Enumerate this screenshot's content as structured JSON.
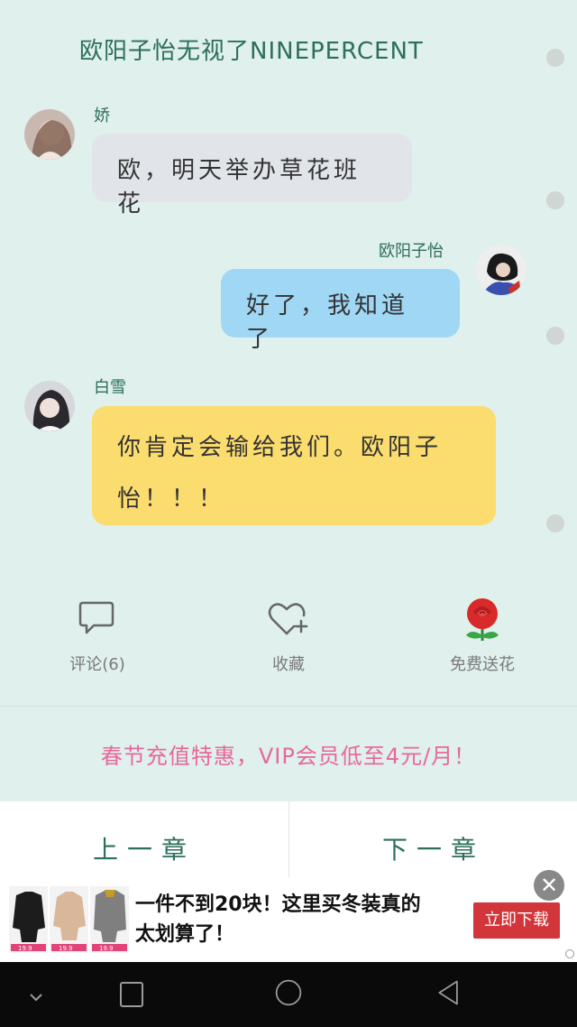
{
  "chapter": {
    "title": "欧阳子怡无视了NINEPERCENT"
  },
  "messages": [
    {
      "sender": "娇",
      "text": "欧，明天举办草花班花",
      "side": "left",
      "bubble_color": "#e1e5ea"
    },
    {
      "sender": "欧阳子怡",
      "text": "好了，我知道了",
      "side": "right",
      "bubble_color": "#9fd7f4"
    },
    {
      "sender": "白雪",
      "text_line1": "你肯定会输给我们。欧阳子",
      "text_line2": "怡！！！",
      "side": "left",
      "bubble_color": "#fbdc6e"
    }
  ],
  "actions": {
    "comment_label": "评论(6)",
    "favorite_label": "收藏",
    "flower_label": "免费送花"
  },
  "promo": {
    "text": "春节充值特惠，VIP会员低至4元/月！",
    "color": "#e8689a"
  },
  "chapter_nav": {
    "prev_label": "上一章",
    "next_label": "下一章"
  },
  "ad": {
    "line1": "一件不到20块！这里买冬装真的",
    "line2": "太划算了！",
    "button_label": "立即下载",
    "close_icon": "close-icon",
    "thumb_price": "19.9"
  },
  "system_nav": {
    "icons": [
      "chevron-down-icon",
      "recent-apps-icon",
      "home-icon",
      "back-icon"
    ]
  },
  "colors": {
    "background": "#dff0ed",
    "accent_text": "#2d6e5c"
  }
}
